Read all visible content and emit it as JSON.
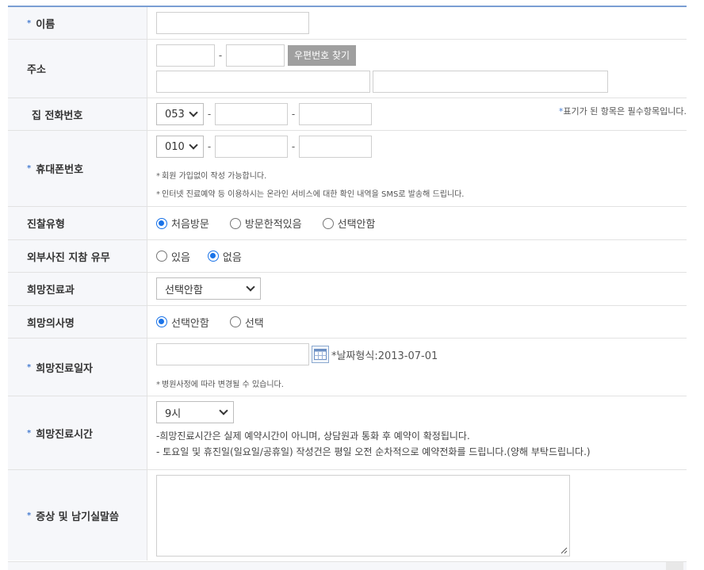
{
  "rows": {
    "name": {
      "label": "이름",
      "required": true
    },
    "address": {
      "label": "주소",
      "zip_button": "우편번호 찾기"
    },
    "home_phone": {
      "label": "집 전화번호",
      "area_code": "053",
      "required_note_star": "*",
      "required_note": "표기가 된 항목은 필수항목입니다."
    },
    "mobile": {
      "label": "휴대폰번호",
      "required": true,
      "prefix": "010",
      "note1": "회원 가입없이 작성 가능합니다.",
      "note2": "인터넷 진료예약 등 이용하시는 온라인 서비스에 대한 확인 내역을 SMS로 발송해 드립니다."
    },
    "visit_type": {
      "label": "진찰유형",
      "options": [
        "처음방문",
        "방문한적있음",
        "선택안함"
      ],
      "selected": 0
    },
    "external_photo": {
      "label": "외부사진 지참 유무",
      "options": [
        "있음",
        "없음"
      ],
      "selected": 1
    },
    "department": {
      "label": "희망진료과",
      "value": "선택안함"
    },
    "doctor": {
      "label": "희망의사명",
      "options": [
        "선택안함",
        "선택"
      ],
      "selected": 0
    },
    "date": {
      "label": "희망진료일자",
      "required": true,
      "format_star": "*",
      "format_text": "날짜형식:2013-07-01",
      "note": "병원사정에 따라 변경될 수 있습니다."
    },
    "time": {
      "label": "희망진료시간",
      "required": true,
      "value": "9시",
      "note1": "-희망진료시간은 실제 예약시간이 아니며, 상담원과 통화 후 예약이 확정됩니다.",
      "note2": "- 토요일 및 휴진일(일요일/공휴일) 작성건은 평일 오전 순차적으로 예약전화를 드립니다.(양해 부탁드립니다.)"
    },
    "symptoms": {
      "label": "증상 및 남기실말씀",
      "required": true
    }
  },
  "required_star": "*",
  "colors": {
    "accent": "#1a73e8",
    "header_bg": "#f6f7fa",
    "border": "#e2e2e2",
    "star": "#4a7fd1"
  }
}
